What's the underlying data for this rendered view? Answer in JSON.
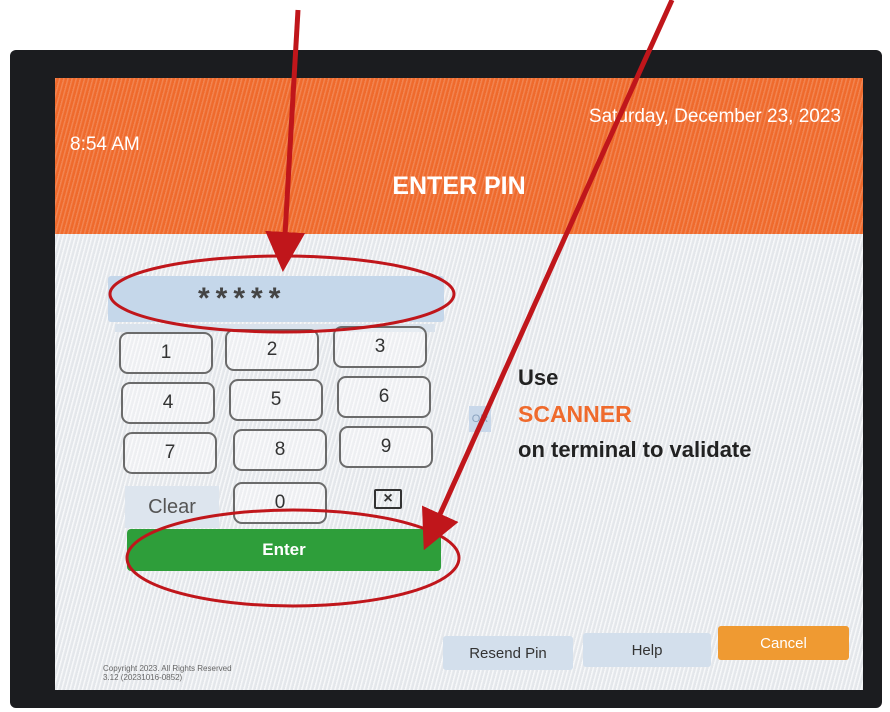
{
  "header": {
    "time": "8:54 AM",
    "date": "Saturday, December 23, 2023",
    "title": "ENTER PIN"
  },
  "pin": {
    "masked_value": "*****"
  },
  "keypad": {
    "keys": [
      "1",
      "2",
      "3",
      "4",
      "5",
      "6",
      "7",
      "8",
      "9"
    ],
    "clear_label": "Clear",
    "zero_label": "0",
    "backspace_icon": "backspace-icon"
  },
  "enter_label": "Enter",
  "scanner": {
    "line1": "Use",
    "line2": "SCANNER",
    "line3": "on terminal to validate",
    "or_label": "OR"
  },
  "footer": {
    "copyright_line1": "Copyright 2023. All Rights Reserved",
    "copyright_line2": "3.12 (20231016-0852)",
    "resend_label": "Resend Pin",
    "help_label": "Help",
    "cancel_label": "Cancel"
  },
  "colors": {
    "header": "#ef6a2c",
    "enter": "#2e9e3a",
    "cancel": "#ef9a32",
    "annotation": "#c0161b"
  }
}
